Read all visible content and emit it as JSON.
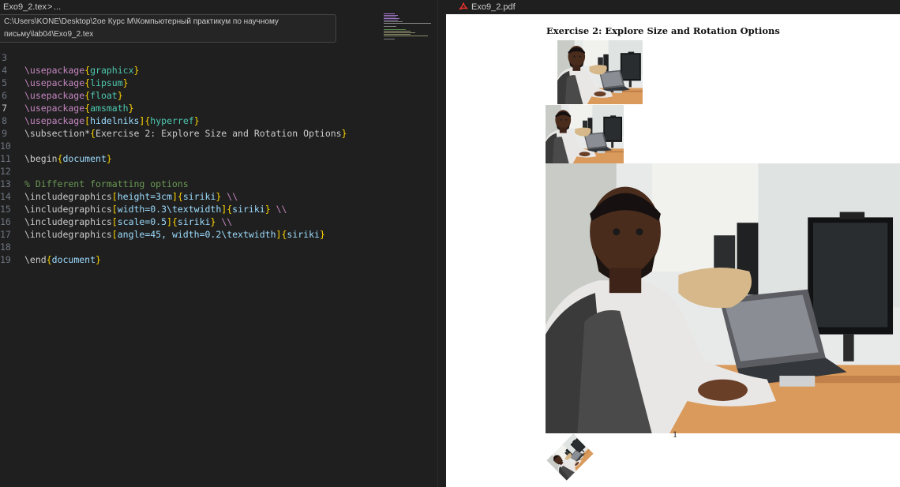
{
  "editor": {
    "breadcrumb": {
      "file": "Exo9_2.tex",
      "separator": ">",
      "ellipsis": "..."
    },
    "path_tooltip": {
      "line1": "C:\\Users\\KONE\\Desktop\\2ое Курс М\\Компьютерный практикум по научному",
      "line2": "письму\\lab04\\Exo9_2.tex"
    },
    "lines": [
      {
        "n": "3"
      },
      {
        "n": "4"
      },
      {
        "n": "5"
      },
      {
        "n": "6"
      },
      {
        "n": "7"
      },
      {
        "n": "8"
      },
      {
        "n": "9"
      },
      {
        "n": "10"
      },
      {
        "n": "11"
      },
      {
        "n": "12"
      },
      {
        "n": "13"
      },
      {
        "n": "14"
      },
      {
        "n": "15"
      },
      {
        "n": "16"
      },
      {
        "n": "17"
      },
      {
        "n": "18"
      },
      {
        "n": "19"
      }
    ],
    "active_line": "7",
    "tokens": {
      "usepackage": "\\usepackage",
      "graphicx": "graphicx",
      "lipsum": "lipsum",
      "float": "float",
      "amsmath": "amsmath",
      "hidelinks": "hidelniks",
      "hyperref": "hyperref",
      "subsection": "\\subsection*",
      "subsection_arg": "Exercise 2: Explore Size and Rotation Options",
      "begin": "\\begin",
      "end": "\\end",
      "document": "document",
      "comment": "% Different formatting options",
      "includegraphics": "\\includegraphics",
      "opt_height": "height=3cm",
      "opt_width": "width=0.3\\textwidth",
      "opt_scale": "scale=0.5",
      "opt_angle": "angle=45, width=0.2\\textwidth",
      "siriki": "siriki",
      "linebreak": "\\\\"
    }
  },
  "viewer": {
    "tab_label": "Exo9_2.pdf",
    "pdf_title": "Exercise 2: Explore Size and Rotation Options",
    "page_number": "1",
    "images": [
      "siriki",
      "siriki",
      "siriki",
      "siriki"
    ]
  },
  "colors": {
    "editor_bg": "#1f1f1f",
    "keyword": "#c586c0",
    "bracket": "#ffd700",
    "argument": "#4ec9b0",
    "option": "#9cdcfe",
    "comment": "#6a9955",
    "pdf_icon": "#e5322d"
  },
  "icons": {
    "pdf_tab": "pdf-file-icon"
  }
}
